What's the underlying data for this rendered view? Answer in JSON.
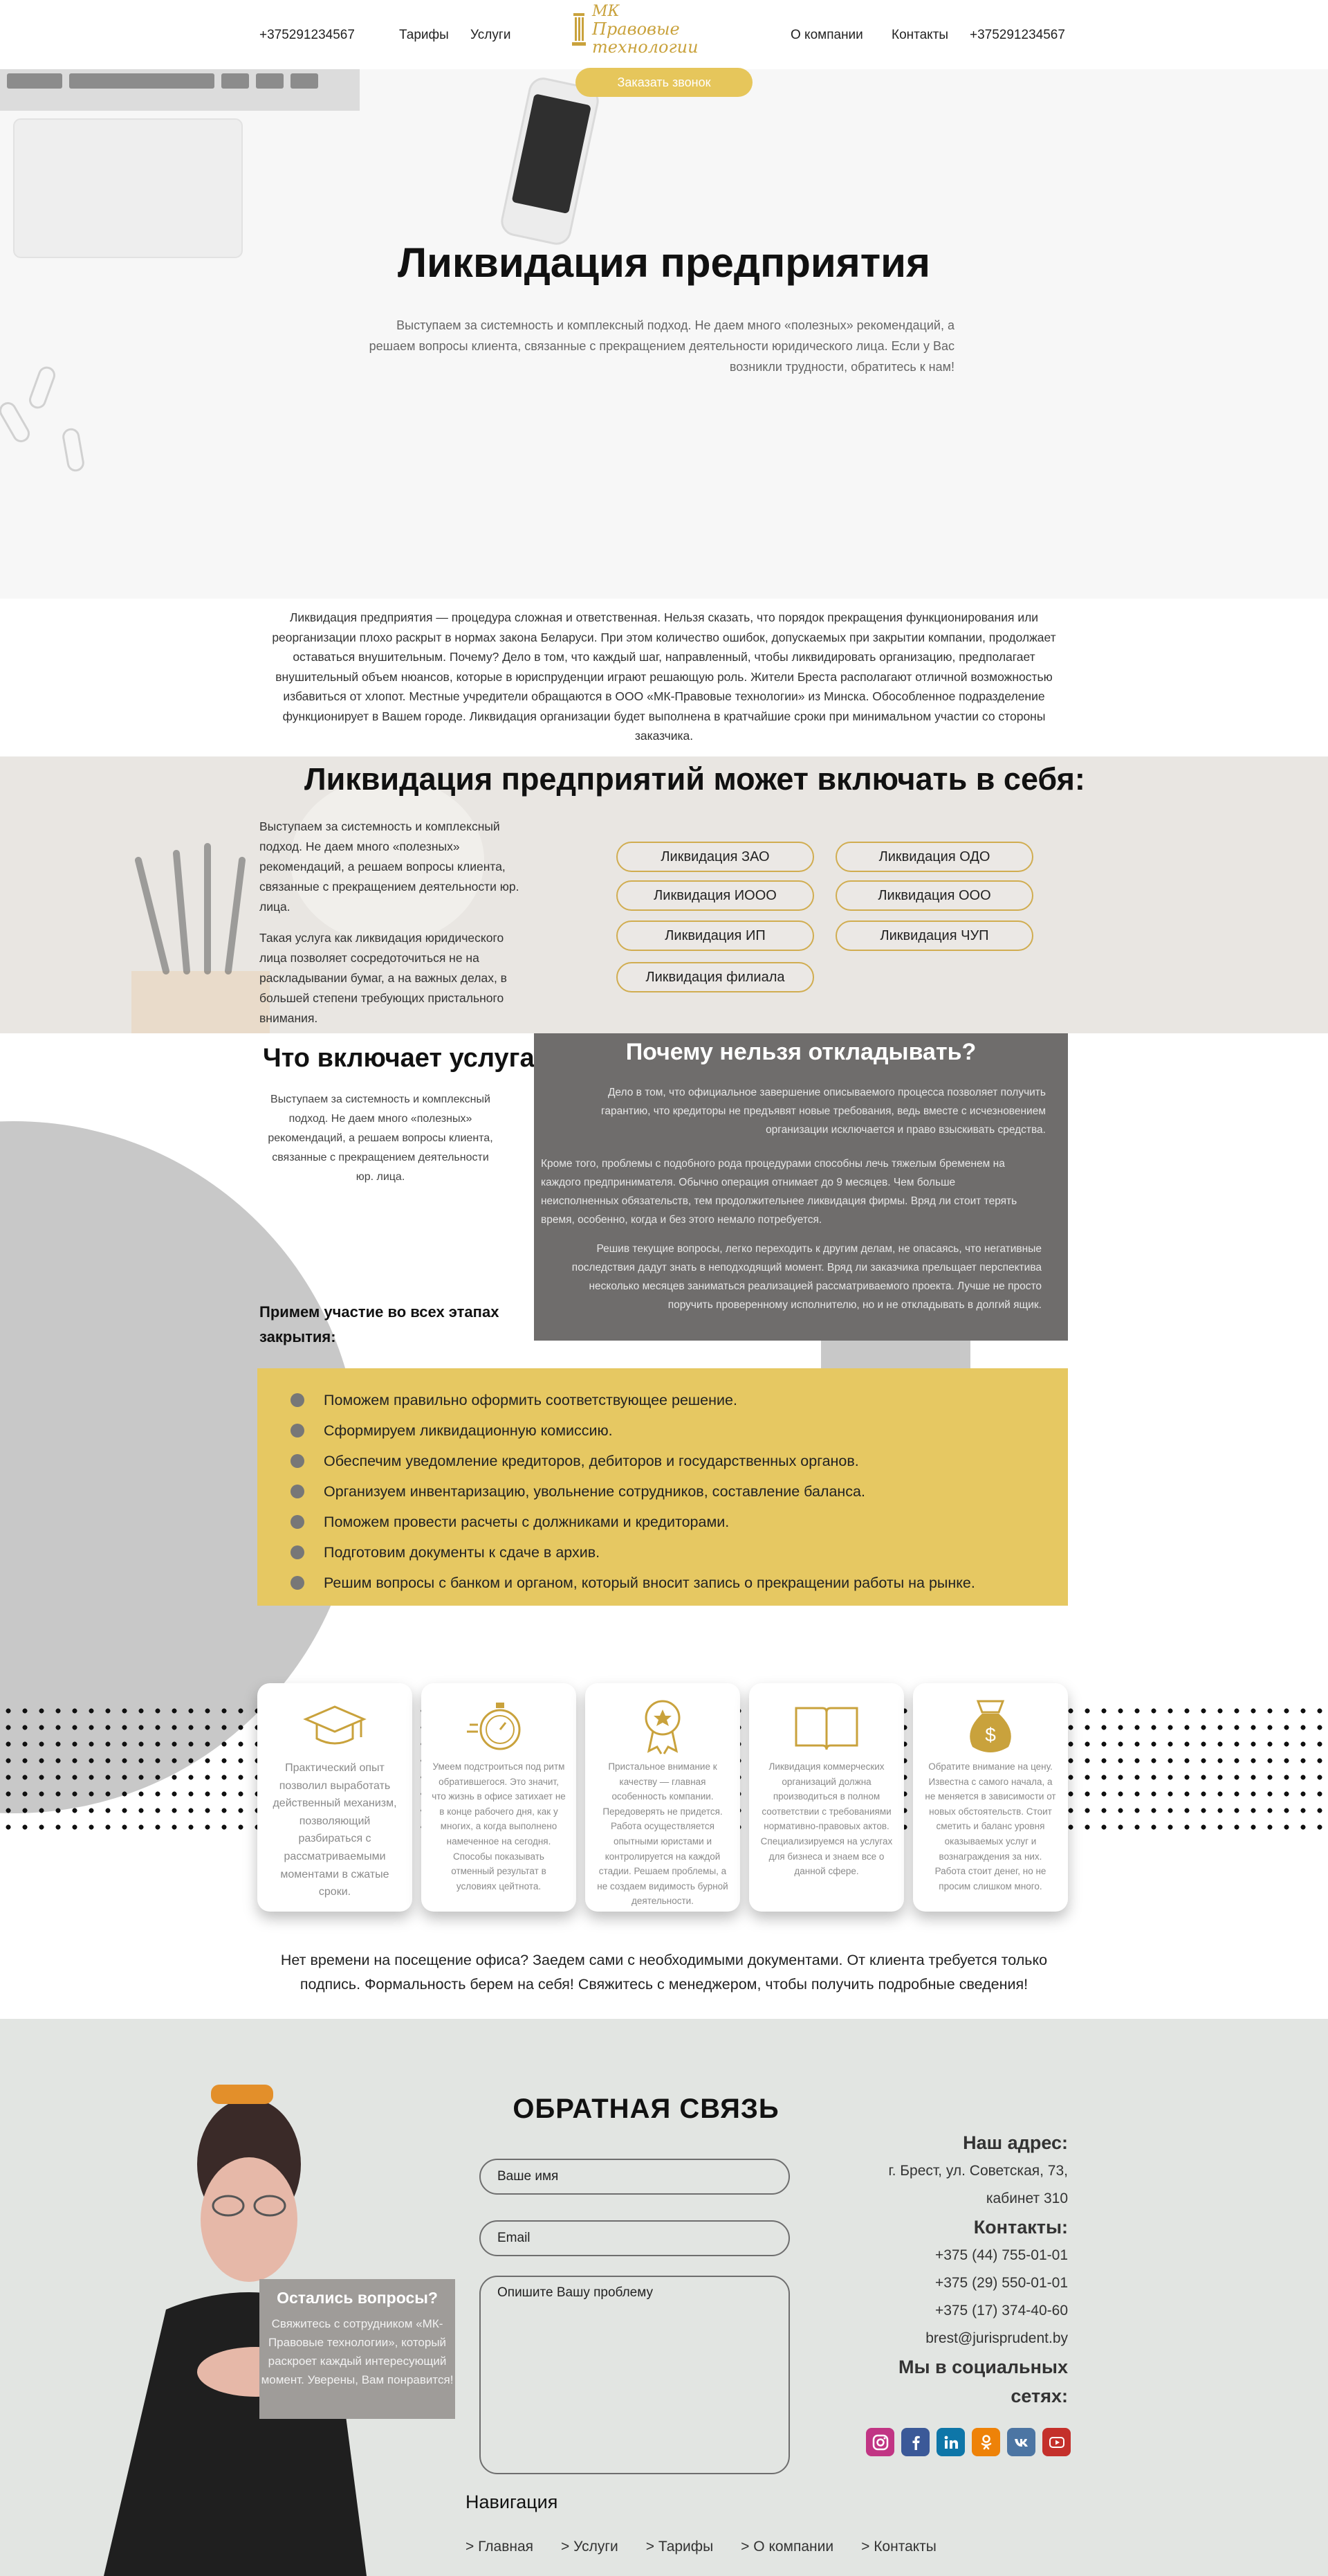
{
  "header": {
    "phone_left": "+375291234567",
    "nav_tariffs": "Тарифы",
    "nav_services": "Услуги",
    "logo_line1": "МК",
    "logo_line2": "Правовые технологии",
    "nav_about": "О компании",
    "nav_contacts": "Контакты",
    "phone_right": "+375291234567",
    "call_button": "Заказать звонок"
  },
  "hero": {
    "title": "Ликвидация предприятия",
    "text": "Выступаем за системность и комплексный подход. Не даем много «полезных» рекомендаций, а решаем вопросы клиента, связанные с прекращением деятельности юридического лица. Если у Вас возникли трудности, обратитесь к нам!"
  },
  "intro": {
    "text": "Ликвидация предприятия — процедура сложная и ответственная. Нельзя сказать, что порядок прекращения функционирования или реорганизации плохо раскрыт в нормах закона Беларуси. При этом количество ошибок, допускаемых при закрытии компании, продолжает оставаться внушительным. Почему? Дело в том, что каждый шаг, направленный, чтобы ликвидировать организацию, предполагает внушительный объем нюансов, которые в юриспруденции играют решающую роль. Жители Бреста располагают отличной возможностью избавиться от хлопот. Местные учредители обращаются в ООО «МК-Правовые технологии» из Минска. Обособленное подразделение функционирует в Вашем городе. Ликвидация организации будет выполнена в кратчайшие сроки при минимальном участии со стороны заказчика."
  },
  "includes": {
    "title": "Ликвидация предприятий может включать в себя:",
    "para1": "Выступаем за системность и комплексный подход. Не даем много «полезных» рекомендаций, а решаем вопросы клиента, связанные с прекращением деятельности юр. лица.",
    "para2": "Такая услуга как ликвидация юридического лица позволяет сосредоточиться не на раскладывании бумаг, а на важных делах, в большей степени требующих пристального внимания.",
    "pills": [
      "Ликвидация  ЗАО",
      "Ликвидация ОДО",
      "Ликвидация ИООО",
      "Ликвидация ООО",
      "Ликвидация ИП",
      "Ликвидация ЧУП",
      "Ликвидация филиала"
    ]
  },
  "what": {
    "title": "Что включает услуга?",
    "text": "Выступаем за системность и комплексный подход. Не даем много «полезных» рекомендаций, а решаем вопросы клиента, связанные с прекращением деятельности юр. лица."
  },
  "why": {
    "title": "Почему нельзя откладывать?",
    "p1": "Дело в том, что официальное завершение описываемого процесса позволяет получить гарантию, что кредиторы не предъявят новые требования, ведь вместе с исчезновением организации исключается и право взыскивать средства.",
    "p2": "Кроме того, проблемы с подобного рода процедурами способны лечь тяжелым бременем на каждого предпринимателя. Обычно операция отнимает до 9 месяцев. Чем больше неисполненных обязательств, тем продолжительнее ликвидация фирмы. Вряд ли стоит терять время, особенно, когда и без этого немало потребуется.",
    "p3": "Решив текущие вопросы, легко переходить к другим делам, не опасаясь, что негативные последствия дадут знать в неподходящий момент. Вряд ли заказчика прельщает перспектива несколько месяцев заниматься реализацией рассматриваемого проекта. Лучше не просто поручить проверенному исполнителю, но и не откладывать в долгий ящик."
  },
  "stages": {
    "title": "Примем участие во всех этапах закрытия:",
    "items": [
      "Поможем правильно оформить соответствующее решение.",
      "Сформируем ликвидационную комиссию.",
      "Обеспечим уведомление кредиторов, дебиторов и государственных органов.",
      "Организуем инвентаризацию, увольнение сотрудников, составление баланса.",
      "Поможем провести расчеты с должниками и кредиторами.",
      "Подготовим документы к сдаче в архив.",
      "Решим вопросы с банком и органом, который вносит запись о прекращении работы на рынке."
    ]
  },
  "cards": [
    {
      "icon": "graduation-cap-icon",
      "text": "Практический опыт позволил выработать действенный механизм, позволяющий разбираться с рассматриваемыми моментами в сжатые сроки."
    },
    {
      "icon": "stopwatch-icon",
      "text": "Умеем подстроиться под ритм обратившегося. Это значит, что жизнь в офисе затихает не в конце рабочего дня, как у многих, а когда выполнено намеченное на сегодня. Способы показывать отменный результат в условиях цейтнота."
    },
    {
      "icon": "award-medal-icon",
      "text": "Пристальное внимание к качеству — главная особенность компании. Передоверять не придется. Работа осуществляется опытными юристами и контролируется на каждой стадии. Решаем проблемы, а не создаем видимость бурной деятельности."
    },
    {
      "icon": "open-book-icon",
      "text": "Ликвидация коммерческих организаций должна производиться в полном соответствии с требованиями нормативно-правовых актов. Специализируемся на услугах для бизнеса и знаем все о данной сфере."
    },
    {
      "icon": "money-bag-icon",
      "text": "Обратите внимание на цену. Известна с самого начала, а не меняется в зависимости от новых обстоятельств. Стоит сметить и баланс уровня оказываемых услуг и вознаграждения за них. Работа стоит денег, но не просим слишком много."
    }
  ],
  "nooffice": {
    "text": "Нет времени на посещение офиса? Заедем сами с необходимыми документами. От клиента требуется только подпись. Формальность берем на себя! Свяжитесь с менеджером, чтобы получить подробные сведения!"
  },
  "feedback": {
    "title": "ОБРАТНАЯ СВЯЗЬ",
    "name_placeholder": "Ваше имя",
    "email_placeholder": "Email",
    "problem_placeholder": "Опишите Вашу проблему"
  },
  "question": {
    "title": "Остались вопросы?",
    "text": "Свяжитесь с сотрудником «МК-Правовые технологии», который раскроет каждый интересующий момент. Уверены, Вам понравится!"
  },
  "contacts": {
    "address_title": "Наш адрес:",
    "address_line1": "г. Брест, ул. Советская, 73,",
    "address_line2": "кабинет 310",
    "contacts_title": "Контакты:",
    "phone1": "+375 (44) 755-01-01",
    "phone2": "+375 (29) 550-01-01",
    "phone3": "+375 (17) 374-40-60",
    "email": "brest@jurisprudent.by",
    "social_title_1": "Мы в социальных",
    "social_title_2": "сетях:",
    "socials": [
      {
        "name": "instagram-icon",
        "color": "#c13584"
      },
      {
        "name": "facebook-icon",
        "color": "#3b5998"
      },
      {
        "name": "linkedin-icon",
        "color": "#0e76a8"
      },
      {
        "name": "odnoklassniki-icon",
        "color": "#ee8208"
      },
      {
        "name": "vk-icon",
        "color": "#4c75a3"
      },
      {
        "name": "youtube-icon",
        "color": "#c4302b"
      }
    ]
  },
  "footer_nav": {
    "title": "Навигация",
    "items": [
      "> Главная",
      "> Услуги",
      "> Тарифы",
      "> О компании",
      "> Контакты"
    ]
  },
  "colors": {
    "accent_gold": "#e6c65b",
    "pill_border": "#d1ad50",
    "why_bg": "#6f6d6c",
    "stages_bg": "#e6c862",
    "footer_bg": "#e2e5e2"
  }
}
